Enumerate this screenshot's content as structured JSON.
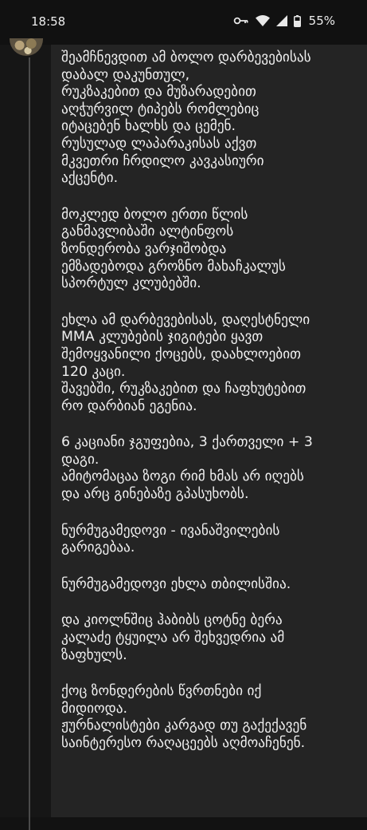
{
  "status_bar": {
    "time": "18:58",
    "battery_percent": "55%",
    "icons": [
      "vpn-key-icon",
      "wifi-icon",
      "cell-signal-icon",
      "battery-icon"
    ]
  },
  "post": {
    "paragraphs": [
      [
        "შეამჩნევდით ამ ბოლო დარბევებისას",
        "დაბალ დაკუნთულ,",
        "რუკზაკებით და მუზარადებით",
        "აღჭურვილ ტიპებს რომლებიც",
        "იტაცებენ ხალხს და ცემენ.",
        "რუსულად ლაპარაკისას აქვთ",
        "მკვეთრი ჩრდილო კავკასიური",
        "აქცენტი."
      ],
      [
        "მოკლედ ბოლო ერთი წლის",
        "განმავლიბაში ალტინფოს",
        "ზონდერობა ვარჯიშობდა",
        "ემზადებოდა გროზნო მახაჩკალუს",
        "სპორტულ კლუბებში."
      ],
      [
        "ეხლა ამ დარბევებისას, დაღესტნელი",
        "MMA კლუბების ჯიგიტები ყავთ",
        "შემოყვანილი ქოცებს, დაახლოებით",
        "120 კაცი.",
        "შავებში, რუკზაკებით და ჩაფხუტებით",
        "რო დარბიან ეგენია."
      ],
      [
        "6 კაციანი ჯგუფებია, 3 ქართველი + 3",
        "დაგი.",
        "ამიტომაცაა ზოგი რიმ ხმას არ იღებს",
        "და არც გინებაზე გპასუხობს."
      ],
      [
        "ნურმუგამედოვი - ივანაშვილების",
        "გარიგებაა."
      ],
      [
        "ნურმუგამედოვი ეხლა თბილისშია."
      ],
      [
        "და კიოლნშიც ჰაბიბს ცოტნე ბერა",
        "კალაძე ტყუილა არ შეხვედრია ამ",
        "ზაფხულს."
      ],
      [
        "ქოც ზონდერების წვრთნები იქ",
        "მიდიოდა.",
        "ჟურნალისტები კარგად თუ გაქექავენ",
        "საინტერესო რაღაცეებს აღმოაჩენენ."
      ]
    ]
  },
  "colors": {
    "background": "#161616",
    "bubble": "#242424",
    "text": "#f0f0f0",
    "thread_line": "#4a4a4a"
  }
}
